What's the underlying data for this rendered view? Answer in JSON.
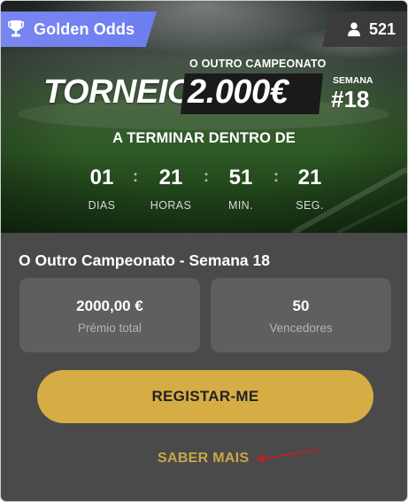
{
  "banner": {
    "badge_label": "Golden Odds",
    "players_count": "521",
    "subtitle": "O OUTRO CAMPEONATO",
    "tournament_word": "TORNEIO",
    "prize_amount": "2.000€",
    "week_label": "SEMANA",
    "week_number": "#18",
    "ending_label": "A TERMINAR DENTRO DE",
    "countdown": [
      {
        "value": "01",
        "label": "DIAS"
      },
      {
        "value": "21",
        "label": "HORAS"
      },
      {
        "value": "51",
        "label": "MIN."
      },
      {
        "value": "21",
        "label": "SEG."
      }
    ],
    "separator": ":"
  },
  "competition": {
    "title": "O Outro Campeonato - Semana 18",
    "stats": [
      {
        "value": "2000,00 €",
        "label": "Prémio total"
      },
      {
        "value": "50",
        "label": "Vencedores"
      }
    ]
  },
  "actions": {
    "register_label": "REGISTAR-ME",
    "learn_more_label": "SABER MAIS"
  },
  "colors": {
    "card_bg": "#4a4a4a",
    "stat_box_bg": "#5f5f5f",
    "badge_bg": "#7a86f0",
    "accent_gold": "#d5ad44",
    "learn_more_text": "#c9a74c",
    "annotation_arrow": "#d11a1a"
  },
  "icons": {
    "badge": "trophy-icon",
    "players": "user-icon",
    "annotation": "red-arrow-icon"
  }
}
